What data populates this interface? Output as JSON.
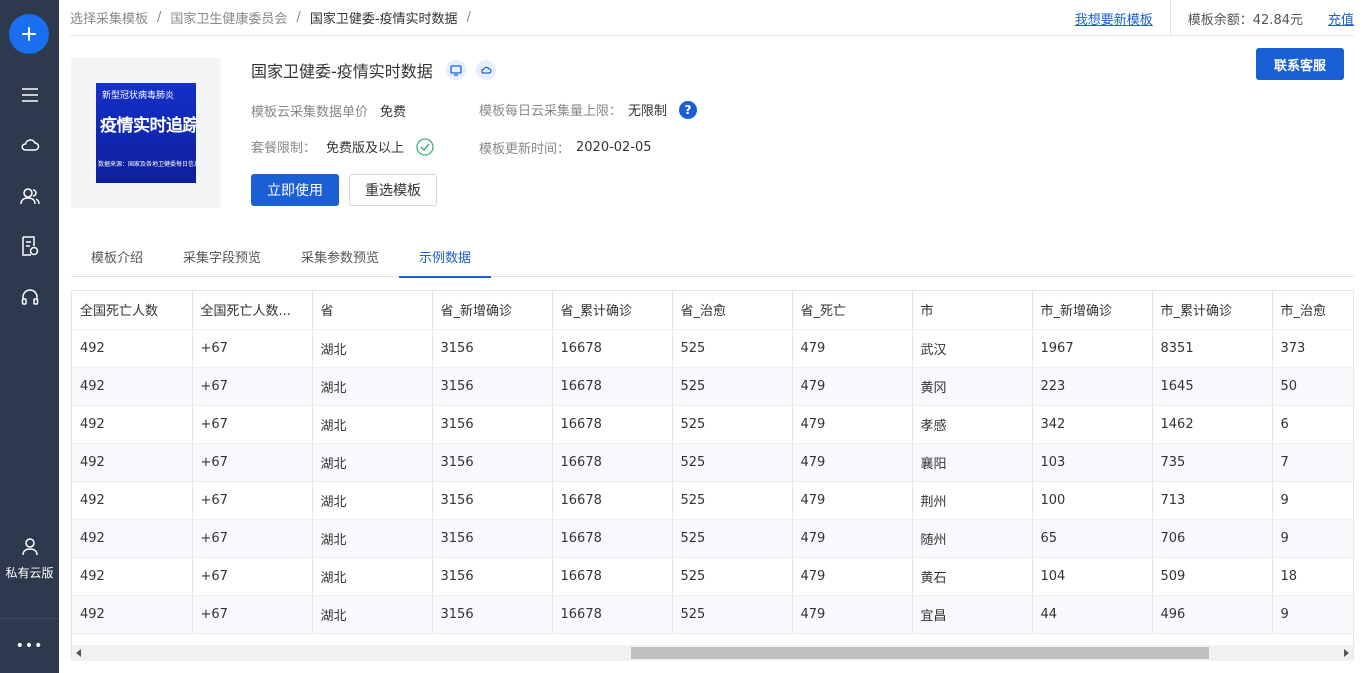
{
  "sidebar": {
    "private_cloud_label": "私有云版",
    "more_label": "•••"
  },
  "breadcrumb": [
    "选择采集模板",
    "国家卫生健康委员会",
    "国家卫健委-疫情实时数据"
  ],
  "breadcrumb_separator": "/",
  "header": {
    "request_template": "我想要新模板",
    "balance": "模板余额：42.84元",
    "recharge": "充值"
  },
  "thumbnail": {
    "line1": "新型冠状病毒肺炎",
    "line2": "疫情实时追踪",
    "line3": "数据来源：国家及各地卫健委每日信息发布"
  },
  "template": {
    "title": "国家卫健委-疫情实时数据",
    "price_label": "模板云采集数据单价",
    "price_value": "免费",
    "daily_limit_label": "模板每日云采集量上限：",
    "daily_limit_value": "无限制",
    "plan_label": "套餐限制：",
    "plan_value": "免费版及以上",
    "updated_label": "模板更新时间：",
    "updated_value": "2020-02-05",
    "use_button": "立即使用",
    "reselect_button": "重选模板",
    "contact_button": "联系客服"
  },
  "tabs": [
    {
      "label": "模板介绍",
      "active": false
    },
    {
      "label": "采集字段预览",
      "active": false
    },
    {
      "label": "采集参数预览",
      "active": false
    },
    {
      "label": "示例数据",
      "active": true
    }
  ],
  "table": {
    "columns": [
      "全国死亡人数",
      "全国死亡人数...",
      "省",
      "省_新增确诊",
      "省_累计确诊",
      "省_治愈",
      "省_死亡",
      "市",
      "市_新增确诊",
      "市_累计确诊",
      "市_治愈"
    ],
    "rows": [
      [
        "492",
        "+67",
        "湖北",
        "3156",
        "16678",
        "525",
        "479",
        "武汉",
        "1967",
        "8351",
        "373"
      ],
      [
        "492",
        "+67",
        "湖北",
        "3156",
        "16678",
        "525",
        "479",
        "黄冈",
        "223",
        "1645",
        "50"
      ],
      [
        "492",
        "+67",
        "湖北",
        "3156",
        "16678",
        "525",
        "479",
        "孝感",
        "342",
        "1462",
        "6"
      ],
      [
        "492",
        "+67",
        "湖北",
        "3156",
        "16678",
        "525",
        "479",
        "襄阳",
        "103",
        "735",
        "7"
      ],
      [
        "492",
        "+67",
        "湖北",
        "3156",
        "16678",
        "525",
        "479",
        "荆州",
        "100",
        "713",
        "9"
      ],
      [
        "492",
        "+67",
        "湖北",
        "3156",
        "16678",
        "525",
        "479",
        "随州",
        "65",
        "706",
        "9"
      ],
      [
        "492",
        "+67",
        "湖北",
        "3156",
        "16678",
        "525",
        "479",
        "黄石",
        "104",
        "509",
        "18"
      ],
      [
        "492",
        "+67",
        "湖北",
        "3156",
        "16678",
        "525",
        "479",
        "宜昌",
        "44",
        "496",
        "9"
      ]
    ]
  },
  "colors": {
    "sidebar_bg": "#2d3a4e",
    "accent": "#1a5fd3",
    "add_button": "#1a6ff0"
  }
}
